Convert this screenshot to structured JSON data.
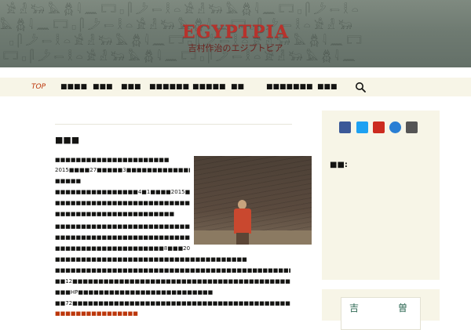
{
  "header": {
    "site_title": "EGYPTPIA",
    "site_description": "吉村作治のエジプトピア"
  },
  "nav": {
    "items": [
      "TOP",
      "■■■■",
      "■■■",
      "■■■",
      "■■■■■■",
      "■■■■■",
      "■■",
      "■■■■■■■",
      "■■■"
    ],
    "active_index": 0,
    "search_icon": "search-icon"
  },
  "main": {
    "page_title": "■■■",
    "paragraphs": [
      "■■■■■■■■■■■■■■■■■■■■■■",
      "2015■■■■27■■■■■3■■■■■■■■■■■■■■■■■■■■■■■■■■■■",
      "■■■■■",
      "■■■■■■■■■■■■■■■■4■1■■■■2015■■■■■■■■■■■■■■■■■■■■■",
      "■■■■■■■■■■■■■■■■■■■■■■■■■■■■■■■■■■■■■■■■■■■■■■■",
      "■■■■■■■■■■■■■■■■■■■■■■■",
      "■■■■■■■■■■■■■■■■■■■■■■■■■■■■■■■■■■■■■■■■■■■■■■■",
      "■■■■■■■■■■■■■■■■■■■■■■■■■■■■■■■■■■■■■■■■■■■■■■■",
      "■■■■■■■■■■■■■■■■■■■■■8■■■2023■■■■■■120■■■■■",
      "■■■■■■■■■■■■■■■■■■■■■■■■■■■■■■■■■■■■■",
      "■■■■■■■■■■■■■■■■■■■■■■■■■■■■■■■■■■■■■■■■■■■■■■■■■■■■■■■■■■■■■■■",
      "■■12■■■■■■■■■■■■■■■■■■■■■■■■■■■■■■■■■■■■■■■■■■■■■■■■■■■■■■■■■■■■■■■■■■■■■■",
      "■■■HP■■■■■■■■■■■■■■■■■■■■■■■■■■",
      "■■72■■■■■■■■■■■■■■■■■■■■■■■■■■■■■■■■■■■■■■■■■■■■■■■■■■■■■■■■■■■■■■■■",
      "■■■■■■■■■■■■■■■■"
    ]
  },
  "sidebar": {
    "social_icons": [
      "facebook-icon",
      "twitter-icon",
      "youtube-icon",
      "itunes-icon",
      "niconico-icon"
    ],
    "social_colors": [
      "#3b5998",
      "#1da1f2",
      "#cc2b1f",
      "#2a7fd4",
      "#555555"
    ],
    "widget_title": "■■:",
    "card_left": "吉",
    "card_right": "曽"
  },
  "colors": {
    "accent": "#bc360a",
    "nav_bg": "#f7f5e7"
  }
}
